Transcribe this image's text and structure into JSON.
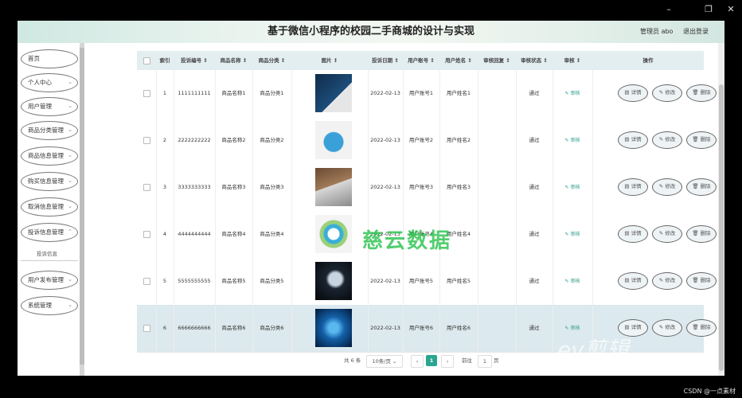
{
  "window": {
    "minimize": "–",
    "maximize": "❐",
    "close": "✕"
  },
  "header": {
    "title": "基于微信小程序的校园二手商城的设计与实现",
    "user": "管理员 abo",
    "logout": "退出登录"
  },
  "sidebar": {
    "items": [
      {
        "label": "首页",
        "chev": ""
      },
      {
        "label": "个人中心",
        "chev": "⌄"
      },
      {
        "label": "用户管理",
        "chev": "⌄"
      },
      {
        "label": "商品分类管理",
        "chev": "⌄"
      },
      {
        "label": "商品信息管理",
        "chev": "⌄"
      },
      {
        "label": "购买信息管理",
        "chev": "⌄"
      },
      {
        "label": "取消信息管理",
        "chev": "⌄"
      },
      {
        "label": "投诉信息管理",
        "chev": "⌃"
      },
      {
        "label": "用户发布管理",
        "chev": "⌄"
      },
      {
        "label": "系统管理",
        "chev": "⌄"
      }
    ],
    "submenu": "投诉信息"
  },
  "table": {
    "headers": [
      "",
      "索引",
      "投诉编号 ↕",
      "商品名称 ↕",
      "商品分类 ↕",
      "图片 ↕",
      "投诉日期 ↕",
      "用户账号 ↕",
      "用户姓名 ↕",
      "审核回复 ↕",
      "审核状态 ↕",
      "审核 ↕",
      "操作"
    ],
    "audit_label": "✎ 审核",
    "buttons": {
      "detail": "▤ 详情",
      "edit": "✎ 修改",
      "delete": "🗑 删除"
    },
    "rows": [
      {
        "index": "1",
        "code": "1111111111",
        "name": "商品名称1",
        "category": "商品分类1",
        "date": "2022-02-13",
        "account": "用户账号1",
        "username": "用户姓名1",
        "reply": "",
        "status": "通过",
        "image": "python-book"
      },
      {
        "index": "2",
        "code": "2222222222",
        "name": "商品名称2",
        "category": "商品分类2",
        "date": "2022-02-13",
        "account": "用户账号2",
        "username": "用户姓名2",
        "reply": "",
        "status": "通过",
        "image": "laptop-illustration"
      },
      {
        "index": "3",
        "code": "3333333333",
        "name": "商品名称3",
        "category": "商品分类3",
        "date": "2022-02-13",
        "account": "用户账号3",
        "username": "用户姓名3",
        "reply": "",
        "status": "通过",
        "image": "laptop-photo"
      },
      {
        "index": "4",
        "code": "4444444444",
        "name": "商品名称4",
        "category": "商品分类4",
        "date": "2022-02-13",
        "account": "用户账号4",
        "username": "用户姓名4",
        "reply": "",
        "status": "通过",
        "image": "circle-diagram"
      },
      {
        "index": "5",
        "code": "5555555555",
        "name": "商品名称5",
        "category": "商品分类5",
        "date": "2022-02-13",
        "account": "用户账号5",
        "username": "用户姓名5",
        "reply": "",
        "status": "通过",
        "image": "robot-dark"
      },
      {
        "index": "6",
        "code": "6666666666",
        "name": "商品名称6",
        "category": "商品分类6",
        "date": "2022-02-13",
        "account": "用户账号6",
        "username": "用户姓名6",
        "reply": "",
        "status": "通过",
        "image": "tech-blue"
      }
    ],
    "selected_row": 6
  },
  "pager": {
    "total": "共 6 条",
    "per_page": "10条/页 ⌄",
    "prev": "‹",
    "page": "1",
    "next": "›",
    "goto_label": "前往",
    "goto_value": "1",
    "page_suffix": "页"
  },
  "watermark": {
    "text": "慈云数据",
    "brand": "ev剪辑"
  },
  "footer": {
    "credit": "CSDN @一点素材"
  },
  "colors": {
    "accent": "#2aa58f",
    "header_bg": "#e3eef0",
    "selected_row": "#dce9ee"
  }
}
